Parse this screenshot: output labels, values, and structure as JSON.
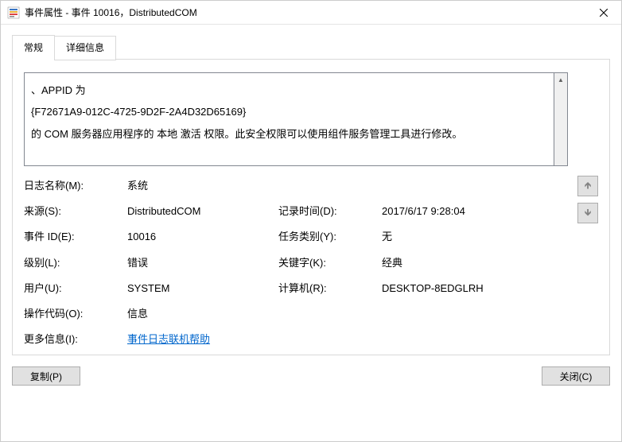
{
  "window": {
    "title": "事件属性 - 事件 10016，DistributedCOM"
  },
  "tabs": {
    "general": "常规",
    "details": "详细信息"
  },
  "description": {
    "line1": "、APPID 为",
    "line2": "{F72671A9-012C-4725-9D2F-2A4D32D65169}",
    "line3": " 的 COM 服务器应用程序的 本地 激活 权限。此安全权限可以使用组件服务管理工具进行修改。"
  },
  "fields": {
    "logName": {
      "label": "日志名称(M):",
      "value": "系统"
    },
    "source": {
      "label": "来源(S):",
      "value": "DistributedCOM"
    },
    "logged": {
      "label": "记录时间(D):",
      "value": "2017/6/17 9:28:04"
    },
    "eventId": {
      "label": "事件 ID(E):",
      "value": "10016"
    },
    "taskCategory": {
      "label": "任务类别(Y):",
      "value": "无"
    },
    "level": {
      "label": "级别(L):",
      "value": "错误"
    },
    "keywords": {
      "label": "关键字(K):",
      "value": "经典"
    },
    "user": {
      "label": "用户(U):",
      "value": "SYSTEM"
    },
    "computer": {
      "label": "计算机(R):",
      "value": "DESKTOP-8EDGLRH"
    },
    "opcode": {
      "label": "操作代码(O):",
      "value": "信息"
    },
    "moreInfo": {
      "label": "更多信息(I):",
      "link": "事件日志联机帮助"
    }
  },
  "buttons": {
    "copy": "复制(P)",
    "close": "关闭(C)"
  }
}
